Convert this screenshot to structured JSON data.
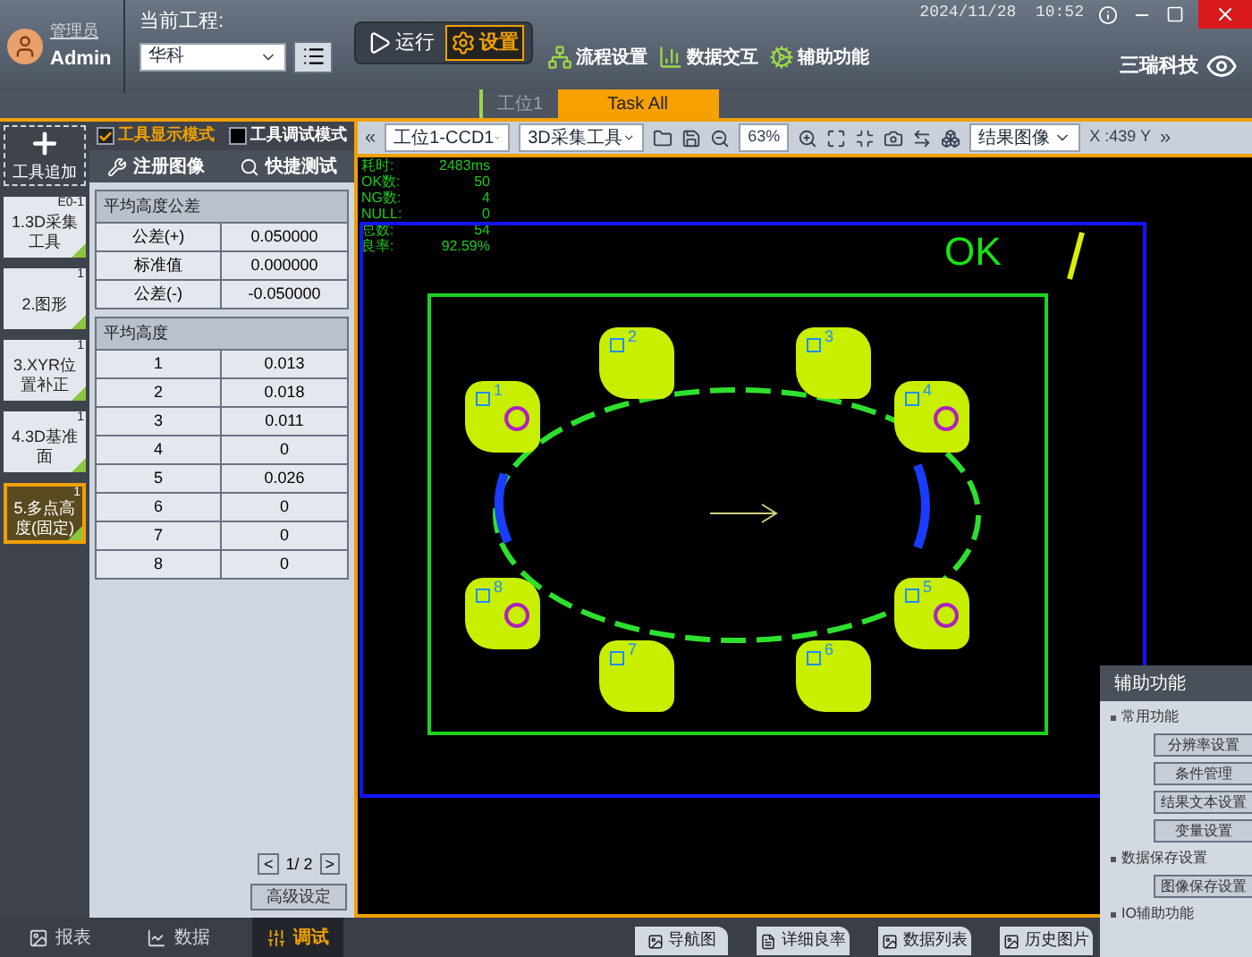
{
  "user": {
    "role": "管理员",
    "name": "Admin"
  },
  "project": {
    "label": "当前工程:",
    "value": "华科"
  },
  "mode_buttons": [
    {
      "label": "运行",
      "kind": "run",
      "selected": false
    },
    {
      "label": "设置",
      "kind": "settings",
      "selected": true
    }
  ],
  "nav": [
    {
      "label": "流程设置",
      "kind": "flow"
    },
    {
      "label": "数据交互",
      "kind": "data"
    },
    {
      "label": "辅助功能",
      "kind": "aux"
    }
  ],
  "datetime": "2024/11/28  10:52",
  "logo": "三瑞科技",
  "tabs": [
    {
      "label": "工位1",
      "selected": false
    },
    {
      "label": "Task All",
      "selected": true
    }
  ],
  "tools": {
    "add": "工具追加",
    "items": [
      {
        "label": "1.3D采集工具",
        "badge": "E0-1",
        "selected": false
      },
      {
        "label": "2.图形",
        "badge": "1",
        "selected": false
      },
      {
        "label": "3.XYR位置补正",
        "badge": "1",
        "selected": false
      },
      {
        "label": "4.3D基准面",
        "badge": "1",
        "selected": false
      },
      {
        "label": "5.多点高度(固定)",
        "badge": "1",
        "selected": true
      }
    ]
  },
  "modes": [
    {
      "label": "工具显示模式",
      "checked": true
    },
    {
      "label": "工具调试模式",
      "checked": false
    }
  ],
  "actions": [
    {
      "label": "注册图像",
      "kind": "register"
    },
    {
      "label": "快捷测试",
      "kind": "test"
    }
  ],
  "tolerance": {
    "title": "平均高度公差",
    "rows": [
      [
        "公差(+)",
        "0.050000"
      ],
      [
        "标准值",
        "0.000000"
      ],
      [
        "公差(-)",
        "-0.050000"
      ]
    ]
  },
  "heights": {
    "title": "平均高度",
    "rows": [
      [
        "1",
        "0.013"
      ],
      [
        "2",
        "0.018"
      ],
      [
        "3",
        "0.011"
      ],
      [
        "4",
        "0"
      ],
      [
        "5",
        "0.026"
      ],
      [
        "6",
        "0"
      ],
      [
        "7",
        "0"
      ],
      [
        "8",
        "0"
      ]
    ]
  },
  "pager": {
    "prev": "<",
    "page": "1/ 2",
    "next": ">"
  },
  "advanced": "高级设定",
  "toolbar": {
    "left": "«",
    "camera": "工位1-CCD1",
    "tool": "3D采集工具",
    "zoom": "63%",
    "view": "结果图像",
    "coord": "X :439 Y",
    "right": "»"
  },
  "canvas": {
    "stats": [
      {
        "label": "耗时:",
        "value": "2483ms"
      },
      {
        "label": "OK数:",
        "value": "50"
      },
      {
        "label": "NG数:",
        "value": "4"
      },
      {
        "label": "NULL:",
        "value": "0"
      },
      {
        "label": "总数:",
        "value": "54"
      },
      {
        "label": "良率:",
        "value": "92.59%"
      }
    ],
    "result": "OK",
    "points": [
      {
        "label": "1",
        "circle": true
      },
      {
        "label": "2",
        "circle": false
      },
      {
        "label": "3",
        "circle": false
      },
      {
        "label": "4",
        "circle": true
      },
      {
        "label": "5",
        "circle": true
      },
      {
        "label": "6",
        "circle": false
      },
      {
        "label": "7",
        "circle": false
      },
      {
        "label": "8",
        "circle": true
      }
    ]
  },
  "bottom_tabs": [
    {
      "label": "报表",
      "kind": "report",
      "selected": false
    },
    {
      "label": "数据",
      "kind": "data",
      "selected": false
    },
    {
      "label": "调试",
      "kind": "debug",
      "selected": true
    }
  ],
  "view_tabs": [
    {
      "label": "导航图",
      "kind": "image"
    },
    {
      "label": "详细良率",
      "kind": "doc"
    },
    {
      "label": "数据列表",
      "kind": "image"
    },
    {
      "label": "历史图片",
      "kind": "image"
    }
  ],
  "aux_panel": {
    "title": "辅助功能",
    "sections": [
      {
        "title": "常用功能",
        "buttons": [
          "分辨率设置",
          "条件管理",
          "结果文本设置",
          "变量设置"
        ]
      },
      {
        "title": "数据保存设置",
        "buttons": [
          "图像保存设置"
        ]
      },
      {
        "title": "IO辅助功能"
      }
    ]
  }
}
